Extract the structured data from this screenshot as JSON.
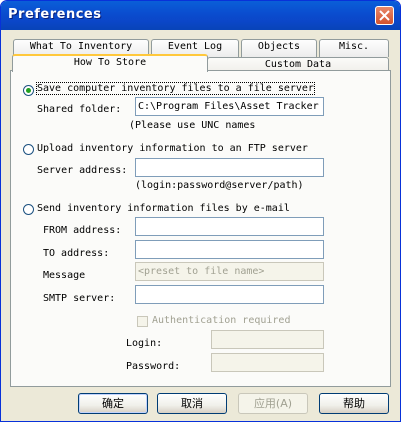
{
  "window": {
    "title": "Preferences"
  },
  "tabs": {
    "row1": [
      "What To Inventory",
      "Event Log",
      "Objects",
      "Misc."
    ],
    "row2": [
      "How To Store",
      "Custom Data"
    ]
  },
  "file_server": {
    "option_label": "Save computer inventory files to a file server",
    "shared_folder_label": "Shared folder:",
    "shared_folder_value": "C:\\Program Files\\Asset Tracker",
    "hint": "(Please use UNC names"
  },
  "ftp": {
    "option_label": "Upload inventory information to an FTP server",
    "server_address_label": "Server address:",
    "server_address_value": "",
    "hint": "(login:password@server/path)"
  },
  "email": {
    "option_label": "Send inventory information files by e-mail",
    "from_label": "FROM address:",
    "to_label": "TO address:",
    "message_label": "Message",
    "message_placeholder": "<preset to file name>",
    "smtp_label": "SMTP server:",
    "auth_label": "Authentication required",
    "login_label": "Login:",
    "password_label": "Password:"
  },
  "buttons": {
    "ok": "确定",
    "cancel": "取消",
    "apply": "应用(A)",
    "help": "帮助"
  },
  "colors": {
    "titlebar": "#0a4ed0",
    "radio_dot": "#21a121",
    "active_tab_accent": "#ffc83c"
  }
}
